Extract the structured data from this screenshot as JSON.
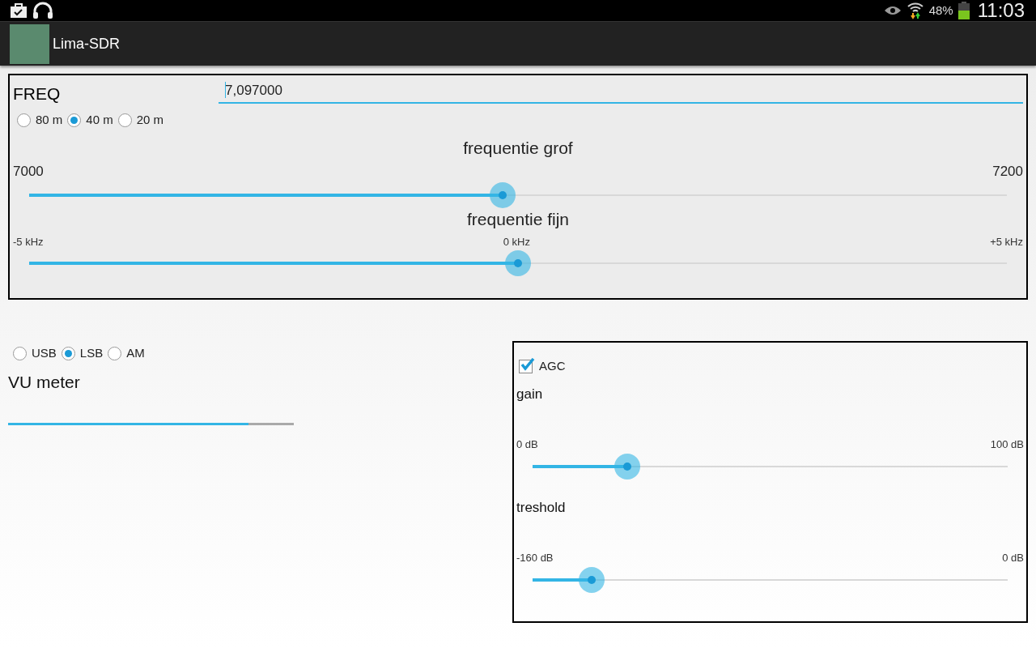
{
  "status_bar": {
    "battery": "48%",
    "time": "11:03"
  },
  "action_bar": {
    "title": "Lima-SDR"
  },
  "freq_panel": {
    "label": "FREQ",
    "value": "7,097000",
    "bands": [
      {
        "label": "80 m",
        "selected": false
      },
      {
        "label": "40 m",
        "selected": true
      },
      {
        "label": "20 m",
        "selected": false
      }
    ],
    "coarse": {
      "title": "frequentie grof",
      "min": "7000",
      "max": "7200",
      "level": 0.484
    },
    "fine": {
      "title": "frequentie fijn",
      "min": "-5 kHz",
      "mid": "0 kHz",
      "max": "+5 kHz",
      "level": 0.5
    }
  },
  "modes": [
    {
      "label": "USB",
      "selected": false
    },
    {
      "label": "LSB",
      "selected": true
    },
    {
      "label": "AM",
      "selected": false
    }
  ],
  "vu_meter": {
    "label": "VU meter",
    "level": 0.84
  },
  "agc_panel": {
    "agc": {
      "label": "AGC",
      "checked": true
    },
    "gain": {
      "title": "gain",
      "min": "0 dB",
      "max": "100 dB",
      "level": 0.2
    },
    "threshold": {
      "title": "treshold",
      "min": "-160 dB",
      "max": "0 dB",
      "level": 0.124
    }
  }
}
